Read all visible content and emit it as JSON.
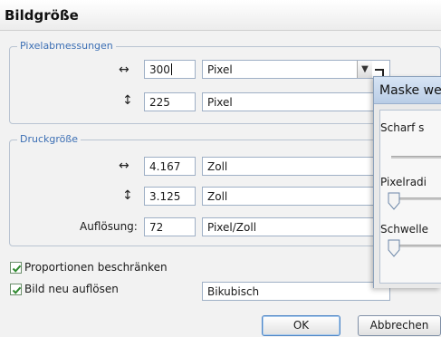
{
  "dialog": {
    "title": "Bildgröße"
  },
  "pixel_dimensions": {
    "legend": "Pixelabmessungen",
    "width": {
      "value": "300",
      "unit": "Pixel"
    },
    "height": {
      "value": "225",
      "unit": "Pixel"
    }
  },
  "print_size": {
    "legend": "Druckgröße",
    "width": {
      "value": "4.167",
      "unit": "Zoll"
    },
    "height": {
      "value": "3.125",
      "unit": "Zoll"
    },
    "resolution": {
      "label": "Auflösung:",
      "value": "72",
      "unit": "Pixel/Zoll"
    }
  },
  "options": {
    "constrain_proportions": {
      "label": "Proportionen beschränken",
      "checked": true
    },
    "resample": {
      "label": "Bild neu auflösen",
      "checked": true,
      "method": "Bikubisch"
    }
  },
  "buttons": {
    "ok": "OK",
    "cancel": "Abbrechen"
  },
  "mask_dialog": {
    "title": "Maske we",
    "labels": {
      "sharpen": "Scharf s",
      "radius": "Pixelradi",
      "threshold": "Schwelle"
    }
  },
  "colors": {
    "legend": "#3c6fb4",
    "group_border": "#b9c4d2",
    "focus": "#4f86c6"
  }
}
